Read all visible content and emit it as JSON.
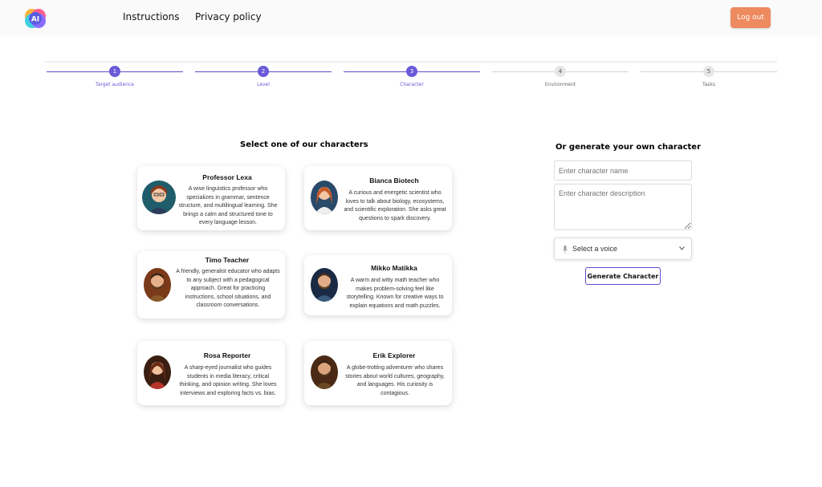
{
  "header": {
    "logo_text": "AI",
    "nav": [
      "Instructions",
      "Privacy policy"
    ],
    "logout_label": "Log out"
  },
  "stepper": {
    "current_step": 3,
    "steps": [
      {
        "number": "1",
        "label": "Target audience"
      },
      {
        "number": "2",
        "label": "Level"
      },
      {
        "number": "3",
        "label": "Character"
      },
      {
        "number": "4",
        "label": "Environment"
      },
      {
        "number": "5",
        "label": "Tasks"
      }
    ]
  },
  "characters": {
    "title": "Select one of our characters",
    "items": [
      {
        "name": "Professor Lexa",
        "description": "A wise linguistics professor who specializes in grammar, sentence structure, and multilingual learning. She brings a calm and structured tone to every language lesson."
      },
      {
        "name": "Bianca Biotech",
        "description": "A curious and energetic scientist who loves to talk about biology, ecosystems, and scientific exploration. She asks great questions to spark discovery."
      },
      {
        "name": "Timo Teacher",
        "description": "A friendly, generalist educator who adapts to any subject with a pedagogical approach. Great for practicing instructions, school situations, and classroom conversations."
      },
      {
        "name": "Mikko Matikka",
        "description": "A warm and witty math teacher who makes problem-solving feel like storytelling. Known for creative ways to explain equations and math puzzles."
      },
      {
        "name": "Rosa Reporter",
        "description": "A sharp-eyed journalist who guides students in media literacy, critical thinking, and opinion writing. She loves interviews and exploring facts vs. bias."
      },
      {
        "name": "Erik Explorer",
        "description": "A globe-trotting adventurer who shares stories about world cultures, geography, and languages. His curiosity is contagious."
      }
    ]
  },
  "generate": {
    "title": "Or generate your own character",
    "name_placeholder": "Enter character name",
    "description_placeholder": "Enter character description",
    "voice_label": "Select a voice",
    "button_label": "Generate Character"
  },
  "colors": {
    "accent": "#6a5ad7",
    "logout": "#ed8a5f"
  }
}
